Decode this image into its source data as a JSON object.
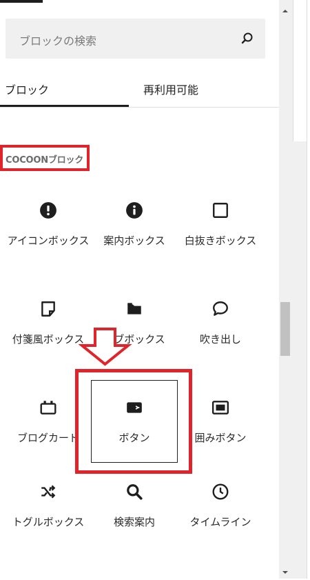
{
  "search": {
    "placeholder": "ブロックの検索"
  },
  "tabs": [
    {
      "label": "ブロック",
      "active": true
    },
    {
      "label": "再利用可能",
      "active": false
    }
  ],
  "category": {
    "title": "COCOONブロック"
  },
  "blocks": [
    {
      "label": "アイコンボックス",
      "icon": "alert-icon"
    },
    {
      "label": "案内ボックス",
      "icon": "info-icon"
    },
    {
      "label": "白抜きボックス",
      "icon": "square-icon"
    },
    {
      "label": "付箋風ボックス",
      "icon": "sticky-note-icon"
    },
    {
      "label": "タブボックス",
      "icon": "folder-tab-icon"
    },
    {
      "label": "吹き出し",
      "icon": "speech-bubble-icon"
    },
    {
      "label": "ブログカード",
      "icon": "blog-card-icon"
    },
    {
      "label": "ボタン",
      "icon": "button-icon"
    },
    {
      "label": "囲みボタン",
      "icon": "wrapped-button-icon"
    },
    {
      "label": "トグルボックス",
      "icon": "shuffle-icon"
    },
    {
      "label": "検索案内",
      "icon": "search-icon"
    },
    {
      "label": "タイムライン",
      "icon": "clock-icon"
    }
  ],
  "colors": {
    "highlight": "#e0242b",
    "text": "#1e1e1e"
  }
}
